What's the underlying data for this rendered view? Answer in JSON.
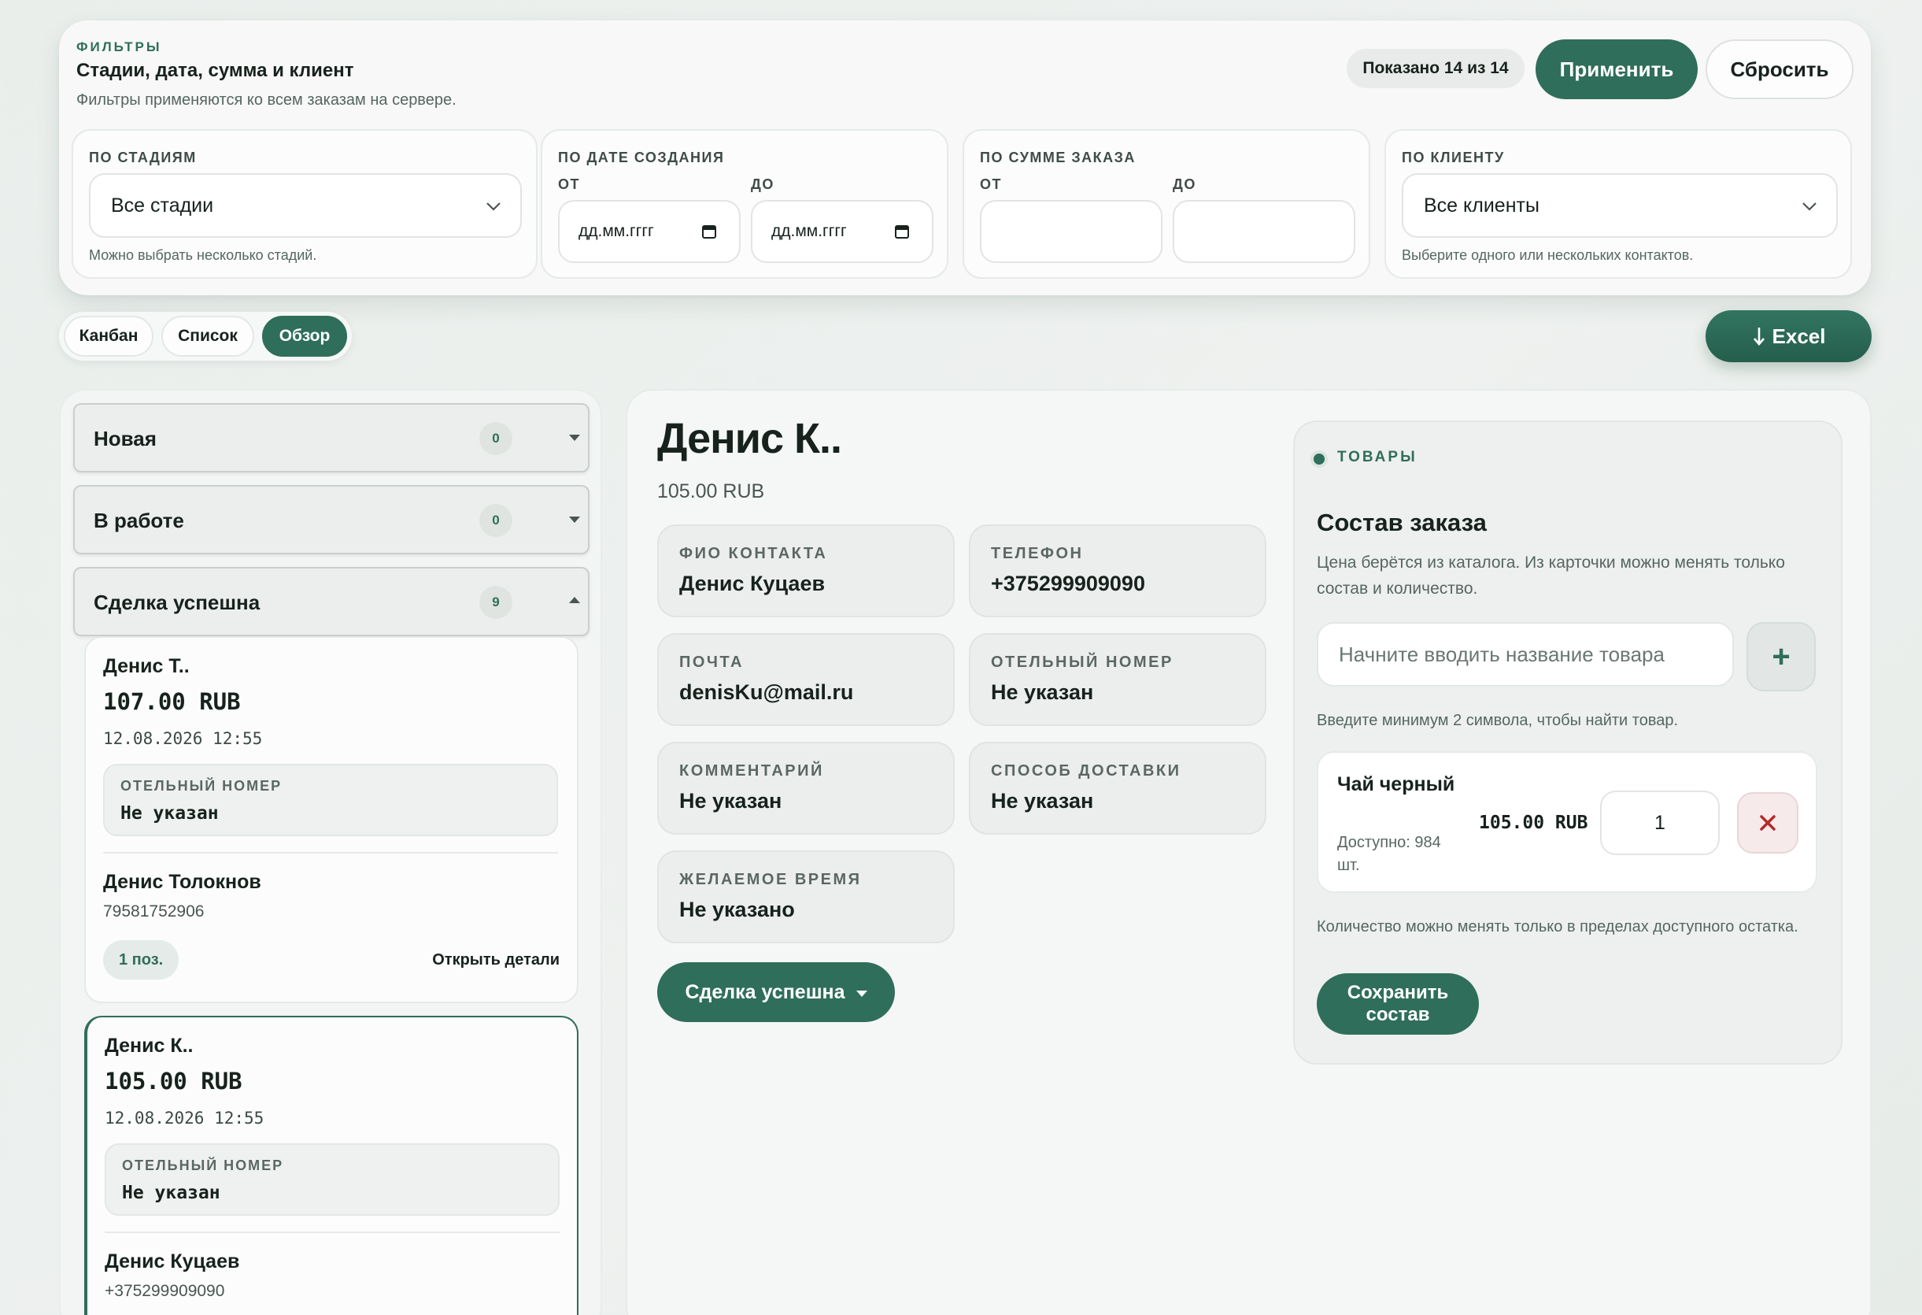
{
  "filters": {
    "eyebrow": "ФИЛЬТРЫ",
    "title": "Стадии, дата, сумма и клиент",
    "subtitle": "Фильтры применяются ко всем заказам на сервере.",
    "shown": "Показано 14 из 14",
    "apply_label": "Применить",
    "reset_label": "Сбросить",
    "stages": {
      "label": "ПО СТАДИЯМ",
      "value": "Все стадии",
      "hint": "Можно выбрать несколько стадий."
    },
    "date": {
      "label": "ПО ДАТЕ СОЗДАНИЯ",
      "from_label": "ОТ",
      "to_label": "ДО",
      "from_placeholder": "дд.мм.гггг",
      "to_placeholder": "дд.мм.гггг"
    },
    "sum": {
      "label": "ПО СУММЕ ЗАКАЗА",
      "from_label": "ОТ",
      "to_label": "ДО",
      "from_value": "",
      "to_value": ""
    },
    "client": {
      "label": "ПО КЛИЕНТУ",
      "value": "Все клиенты",
      "hint": "Выберите одного или нескольких контактов."
    }
  },
  "views": {
    "tabs": [
      "Канбан",
      "Список",
      "Обзор"
    ],
    "active": "Обзор"
  },
  "export_label": "Excel",
  "stages": [
    {
      "name": "Новая",
      "count": "0",
      "expanded": false
    },
    {
      "name": "В работе",
      "count": "0",
      "expanded": false
    },
    {
      "name": "Сделка успешна",
      "count": "9",
      "expanded": true
    }
  ],
  "orders": [
    {
      "name": "Денис Т..",
      "price": "107.00 RUB",
      "date": "12.08.2026 12:55",
      "field_label": "ОТЕЛЬНЫЙ НОМЕР",
      "field_value": "Не указан",
      "contact": "Денис Толокнов",
      "phone": "79581752906",
      "positions": "1 поз.",
      "open_label": "Открыть детали"
    },
    {
      "name": "Денис К..",
      "price": "105.00 RUB",
      "date": "12.08.2026 12:55",
      "field_label": "ОТЕЛЬНЫЙ НОМЕР",
      "field_value": "Не указан",
      "contact": "Денис Куцаев",
      "phone": "+375299909090"
    }
  ],
  "details": {
    "name": "Денис К..",
    "price": "105.00 RUB",
    "fields": [
      {
        "label": "ФИО КОНТАКТА",
        "value": "Денис Куцаев"
      },
      {
        "label": "ТЕЛЕФОН",
        "value": "+375299909090"
      },
      {
        "label": "ПОЧТА",
        "value": "denisKu@mail.ru"
      },
      {
        "label": "ОТЕЛЬНЫЙ НОМЕР",
        "value": "Не указан"
      },
      {
        "label": "КОММЕНТАРИЙ",
        "value": "Не указан"
      },
      {
        "label": "СПОСОБ ДОСТАВКИ",
        "value": "Не указан"
      },
      {
        "label": "ЖЕЛАЕМОЕ ВРЕМЯ",
        "value": "Не указано"
      }
    ],
    "stage_button": "Сделка успешна"
  },
  "goods": {
    "eyebrow": "ТОВАРЫ",
    "title": "Состав заказа",
    "description": "Цена берётся из каталога. Из карточки можно менять только состав и количество.",
    "search_placeholder": "Начните вводить название товара",
    "search_hint": "Введите минимум 2 символа, чтобы найти товар.",
    "item": {
      "name": "Чай черный",
      "stock": "Доступно: 984 шт.",
      "price": "105.00 RUB",
      "qty": "1"
    },
    "note": "Количество можно менять только в пределах доступного остатка.",
    "save_label": "Сохранить состав"
  },
  "colors": {
    "accent": "#2f6e5a",
    "danger": "#b52a2a",
    "background": "#eceff0"
  },
  "icons": [
    "chevron-down-icon",
    "calendar-icon",
    "plus-icon",
    "close-icon",
    "download-arrow-icon",
    "caret-down-icon",
    "status-dot-icon"
  ]
}
